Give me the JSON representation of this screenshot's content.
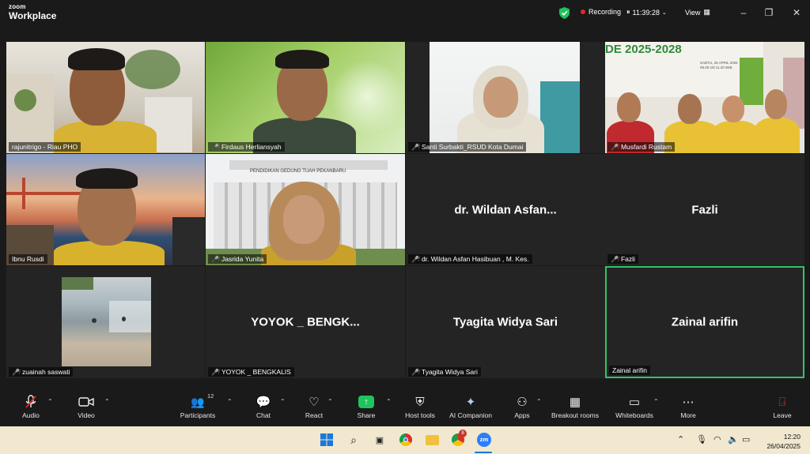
{
  "app": {
    "brand_small": "zoom",
    "brand_big": "Workplace",
    "recording_label": "Recording",
    "clock": "11:39:28",
    "view_label": "View"
  },
  "participants": [
    {
      "name": "rajunitrigo - Riau PHO",
      "muted": false,
      "video": true
    },
    {
      "name": "Firdaus Herliansyah",
      "muted": true,
      "video": true
    },
    {
      "name": "Santi Surbakti_RSUD Kota Dumai",
      "muted": true,
      "video": true
    },
    {
      "name": "Musfardi Rustam",
      "muted": true,
      "video": true
    },
    {
      "name": "Ibnu Rusdi",
      "muted": false,
      "video": true
    },
    {
      "name": "Jasrida Yunita",
      "muted": true,
      "video": true
    },
    {
      "name": "dr. Wildan Asfan Hasibuan , M. Kes.",
      "display": "dr. Wildan Asfan...",
      "muted": true,
      "video": false
    },
    {
      "name": "Fazli",
      "display": "Fazli",
      "muted": true,
      "video": false
    },
    {
      "name": "zuainah saswati",
      "muted": true,
      "video": true
    },
    {
      "name": "YOYOK _ BENGKALIS",
      "display": "YOYOK _ BENGK...",
      "muted": true,
      "video": false
    },
    {
      "name": "Tyagita Widya Sari",
      "display": "Tyagita Widya Sari",
      "muted": true,
      "video": false
    },
    {
      "name": "Zainal arifin",
      "display": "Zainal arifin",
      "muted": false,
      "video": false,
      "active_speaker": true
    }
  ],
  "banner": {
    "title": "DE 2025-2028",
    "line1": "SABTU, 26 APRIL 2025",
    "line2": "09.00 s/d 11.30 WIB",
    "building_sign": "PENDIDIKAN GEDUNG TUAH PEKANBARU"
  },
  "toolbar": {
    "audio": "Audio",
    "video": "Video",
    "participants": "Participants",
    "participants_count": "12",
    "chat": "Chat",
    "react": "React",
    "share": "Share",
    "host_tools": "Host tools",
    "ai_companion": "AI Companion",
    "apps": "Apps",
    "breakout_rooms": "Breakout rooms",
    "whiteboards": "Whiteboards",
    "more": "More",
    "leave": "Leave"
  },
  "taskbar": {
    "time": "12:20",
    "date": "26/04/2025",
    "chrome_badge": "8",
    "zoom_icon": "zm"
  },
  "colors": {
    "share_green": "#1fc45c",
    "leave_red": "#e02828",
    "speaker_border": "#33c36b",
    "taskbar_bg": "#f1e8cf"
  }
}
